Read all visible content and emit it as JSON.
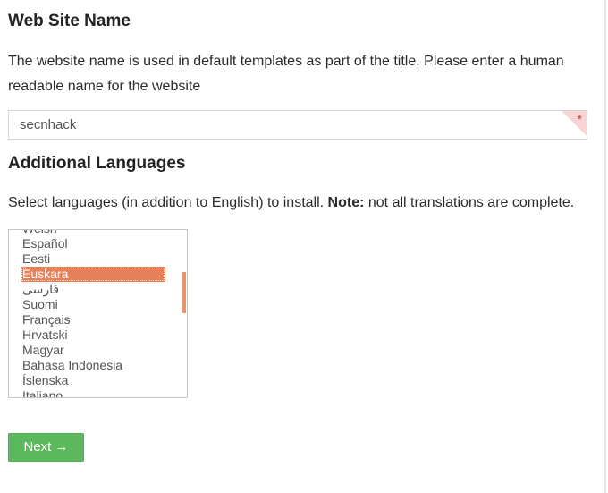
{
  "site_name": {
    "title": "Web Site Name",
    "description": "The website name is used in default templates as part of the title. Please enter a human readable name for the website",
    "input_value": "secnhack",
    "required_marker": "*"
  },
  "languages": {
    "title": "Additional Languages",
    "description_prefix": "Select languages (in addition to English) to install. ",
    "description_note_label": "Note:",
    "description_suffix": " not all translations are complete.",
    "options": [
      {
        "label": "Welsh",
        "selected": false
      },
      {
        "label": "Español",
        "selected": false
      },
      {
        "label": "Eesti",
        "selected": false
      },
      {
        "label": "Euskara",
        "selected": true
      },
      {
        "label": "فارسی",
        "selected": false
      },
      {
        "label": "Suomi",
        "selected": false
      },
      {
        "label": "Français",
        "selected": false
      },
      {
        "label": "Hrvatski",
        "selected": false
      },
      {
        "label": "Magyar",
        "selected": false
      },
      {
        "label": "Bahasa Indonesia",
        "selected": false
      },
      {
        "label": "Íslenska",
        "selected": false
      },
      {
        "label": "Italiano",
        "selected": false
      }
    ]
  },
  "next_button": {
    "label": "Next",
    "arrow": "→"
  },
  "colors": {
    "accent_selected": "#e8805a",
    "button_green": "#5cb85c",
    "required_corner": "#f7d5d5"
  }
}
